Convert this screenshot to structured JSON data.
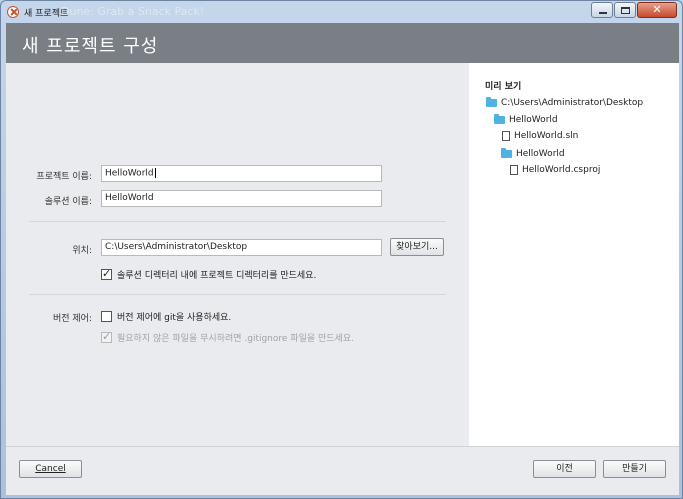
{
  "window": {
    "title": "새 프로젝트",
    "background_ghost": "Dune: Grab a Snack Pack!",
    "close_symbol": "✕"
  },
  "header": {
    "title": "새 프로젝트 구성"
  },
  "form": {
    "project_name": {
      "label": "프로젝트 이름:",
      "value": "HelloWorld"
    },
    "solution_name": {
      "label": "솔루션 이름:",
      "value": "HelloWorld"
    },
    "location": {
      "label": "위치:",
      "value": "C:\\Users\\Administrator\\Desktop",
      "browse_label": "찾아보기..."
    },
    "create_dir_checkbox": {
      "label": "솔루션 디렉터리 내에 프로젝트 디렉터리를 만드세요.",
      "checked": true
    },
    "version_control": {
      "label": "버전 제어:",
      "use_git": {
        "label": "버전 제어에 git을 사용하세요.",
        "checked": false
      },
      "gitignore": {
        "label": "필요하지 않은 파일을 무시하려면 .gitignore 파일을 만드세요.",
        "checked": true,
        "enabled": false
      }
    }
  },
  "preview": {
    "title": "미리 보기",
    "tree": [
      {
        "name": "C:\\Users\\Administrator\\Desktop",
        "type": "folder",
        "depth": 0
      },
      {
        "name": "HelloWorld",
        "type": "folder",
        "depth": 1
      },
      {
        "name": "HelloWorld.sln",
        "type": "file",
        "depth": 2
      },
      {
        "name": "HelloWorld",
        "type": "folder",
        "depth": 2
      },
      {
        "name": "HelloWorld.csproj",
        "type": "file",
        "depth": 3
      }
    ]
  },
  "footer": {
    "cancel_label": "Cancel",
    "previous_label": "이전",
    "create_label": "만들기"
  },
  "colors": {
    "header_bg": "#7a7f86",
    "folder_icon": "#4fb2e3",
    "close_button": "#c64a2e"
  }
}
